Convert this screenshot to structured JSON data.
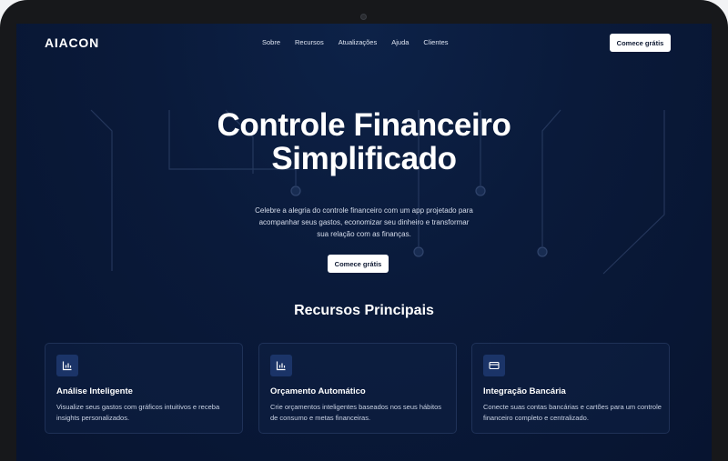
{
  "app": {
    "logo": "AIACON"
  },
  "nav": {
    "links": [
      "Sobre",
      "Recursos",
      "Atualizações",
      "Ajuda",
      "Clientes"
    ],
    "cta": "Comece grátis"
  },
  "hero": {
    "title_line1": "Controle Financeiro",
    "title_line2": "Simplificado",
    "description": "Celebre a alegria do controle financeiro com um app projetado para acompanhar seus gastos, economizar seu dinheiro e transformar sua relação com as finanças.",
    "cta": "Comece grátis"
  },
  "features": {
    "title": "Recursos Principais",
    "cards": [
      {
        "icon": "bar-chart-icon",
        "title": "Análise Inteligente",
        "description": "Visualize seus gastos com gráficos intuitivos e receba insights personalizados."
      },
      {
        "icon": "bar-chart-icon",
        "title": "Orçamento Automático",
        "description": "Crie orçamentos inteligentes baseados nos seus hábitos de consumo e metas financeiras."
      },
      {
        "icon": "credit-card-icon",
        "title": "Integração Bancária",
        "description": "Conecte suas contas bancárias e cartões para um controle financeiro completo e centralizado."
      }
    ]
  },
  "colors": {
    "background": "#0a1a3a",
    "accent": "#1b3468",
    "text": "#ffffff"
  }
}
